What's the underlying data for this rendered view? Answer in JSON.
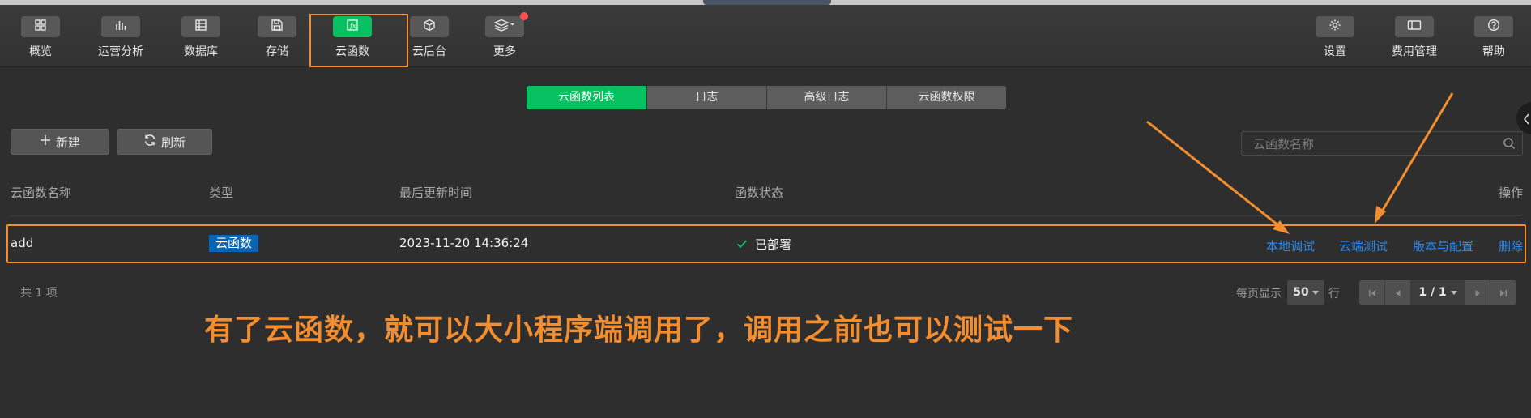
{
  "toolbar": {
    "items": [
      {
        "label": "概览",
        "icon": "grid-icon"
      },
      {
        "label": "运营分析",
        "icon": "bar-chart-icon"
      },
      {
        "label": "数据库",
        "icon": "database-icon"
      },
      {
        "label": "存储",
        "icon": "save-icon"
      },
      {
        "label": "云函数",
        "icon": "function-icon"
      },
      {
        "label": "云后台",
        "icon": "cube-icon"
      },
      {
        "label": "更多",
        "icon": "layers-icon"
      },
      {
        "label": "设置",
        "icon": "gear-icon"
      },
      {
        "label": "费用管理",
        "icon": "card-icon"
      },
      {
        "label": "帮助",
        "icon": "help-icon"
      }
    ],
    "active": "云函数"
  },
  "tabs": [
    {
      "label": "云函数列表",
      "active": true
    },
    {
      "label": "日志",
      "active": false
    },
    {
      "label": "高级日志",
      "active": false
    },
    {
      "label": "云函数权限",
      "active": false
    }
  ],
  "actions": {
    "new_label": "新建",
    "refresh_label": "刷新"
  },
  "search": {
    "placeholder": "云函数名称"
  },
  "table": {
    "headers": [
      "云函数名称",
      "类型",
      "最后更新时间",
      "函数状态",
      "操作"
    ],
    "rows": [
      {
        "name": "add",
        "type": "云函数",
        "updated": "2023-11-20 14:36:24",
        "status": "已部署",
        "ops": [
          "本地调试",
          "云端测试",
          "版本与配置",
          "删除"
        ]
      }
    ]
  },
  "footer": {
    "total": "共 1 项",
    "per_page_label": "每页显示",
    "per_page_value": "50",
    "per_page_suffix": "行",
    "page_indicator": "1 / 1"
  },
  "annotation": "有了云函数，就可以大小程序端调用了，调用之前也可以测试一下",
  "colors": {
    "accent": "#07c160",
    "annotation": "#f28d30",
    "link": "#2d8cf0",
    "badge": "#0b63b3",
    "notify": "#fa5151"
  }
}
